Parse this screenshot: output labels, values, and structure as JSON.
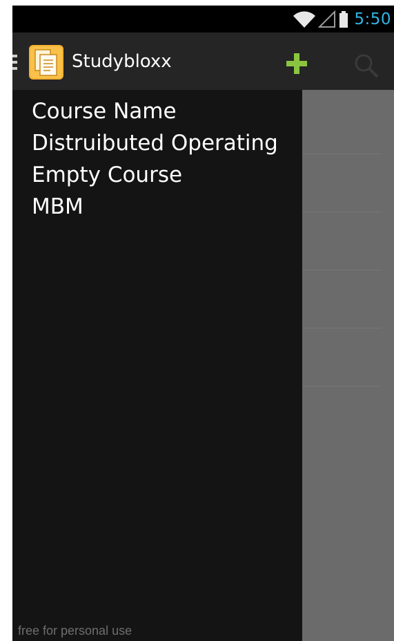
{
  "status_bar": {
    "time": "5:50",
    "icons": [
      "wifi-icon",
      "signal-icon",
      "battery-icon"
    ],
    "clock_color": "#33b5e5"
  },
  "action_bar": {
    "title": "Studybloxx",
    "actions": [
      "add-icon",
      "search-icon"
    ],
    "add_color": "#8bc53f"
  },
  "drawer": {
    "courses": [
      {
        "label": "Course Name"
      },
      {
        "label": "Distruibuted Operating"
      },
      {
        "label": "Empty Course"
      },
      {
        "label": "MBM"
      }
    ],
    "footer": "free for personal use"
  },
  "colors": {
    "drawer_bg": "#141414",
    "action_bar_bg": "#252525",
    "dim_overlay": "#6b6b6b"
  }
}
